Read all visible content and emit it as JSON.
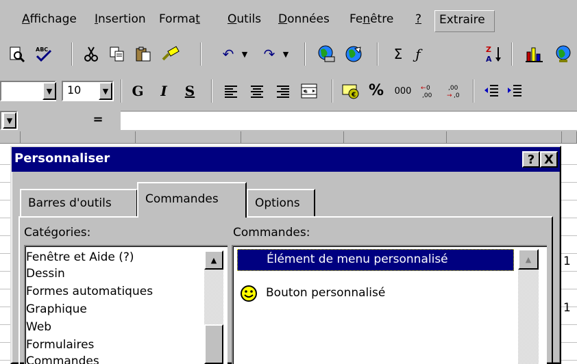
{
  "menubar": {
    "items": [
      {
        "label": "Affichage"
      },
      {
        "label": "Insertion"
      },
      {
        "label": "Format"
      },
      {
        "label": "Outils"
      },
      {
        "label": "Données"
      },
      {
        "label": "Fenêtre"
      },
      {
        "label": "?"
      },
      {
        "label": "Extraire"
      }
    ]
  },
  "formatting": {
    "font_size": "10",
    "bold": "G",
    "italic": "I",
    "underline": "S",
    "percent": "%",
    "thousands": "000"
  },
  "standard": {
    "sigma": "Σ"
  },
  "formula_bar": {
    "equals": "="
  },
  "cells": {
    "row1_value": "1",
    "row2_value": "1"
  },
  "dialog": {
    "title": "Personnaliser",
    "help_button": "?",
    "close_button": "X",
    "tabs": [
      "Barres d'outils",
      "Commandes",
      "Options"
    ],
    "active_tab": "Commandes",
    "categories_label": "Catégories:",
    "commands_label": "Commandes:",
    "categories": [
      "Fenêtre et Aide (?)",
      "Dessin",
      "Formes automatiques",
      "Graphique",
      "Web",
      "Formulaires",
      "Commandes"
    ],
    "commands": [
      {
        "label": "Élément de menu personnalisé",
        "selected": true,
        "icon": "none"
      },
      {
        "label": "Bouton personnalisé",
        "selected": false,
        "icon": "smiley-icon"
      }
    ]
  },
  "colors": {
    "title_bar": "#000080",
    "face": "#c0c0c0",
    "smiley": "#ffff00"
  }
}
